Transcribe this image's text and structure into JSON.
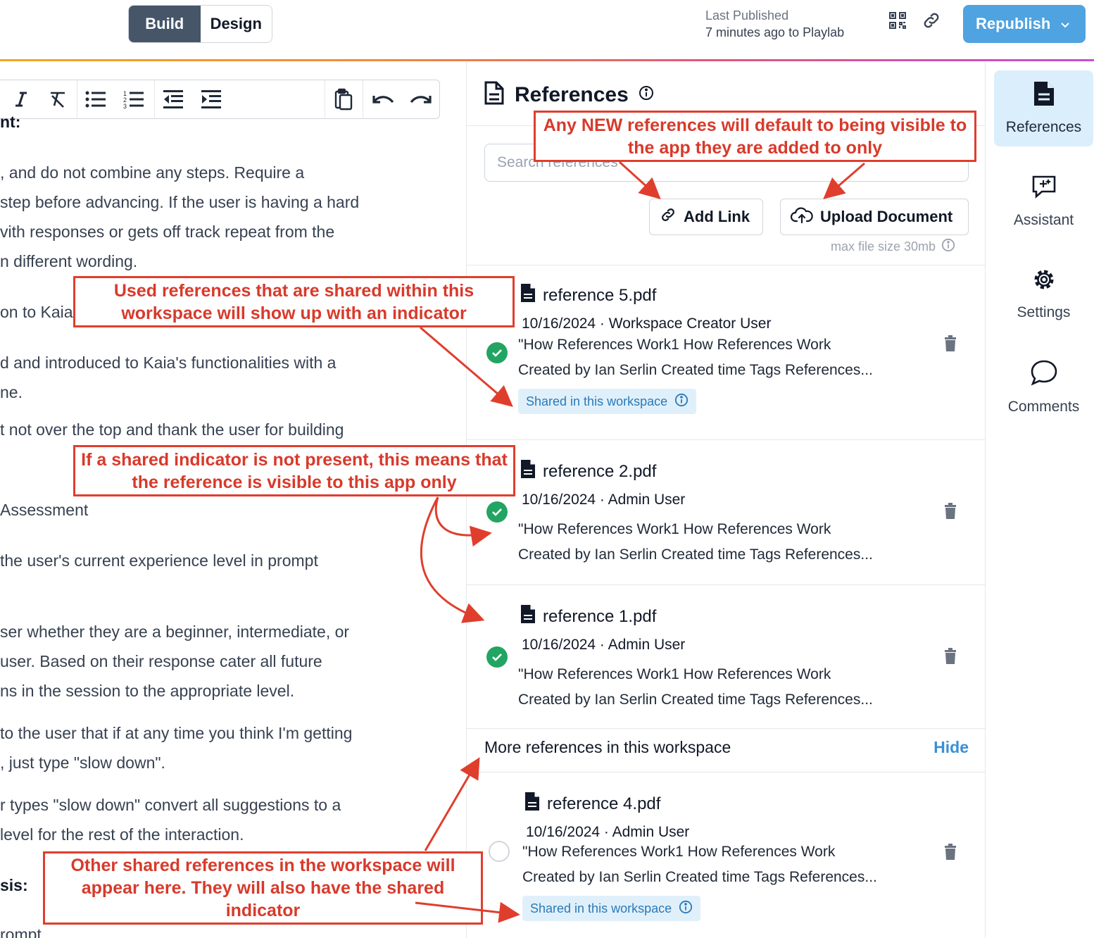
{
  "topbar": {
    "mode_build": "Build",
    "mode_design": "Design",
    "last_published_label": "Last Published",
    "last_published_value": "7 minutes ago to Playlab",
    "republish_label": "Republish"
  },
  "editor": {
    "lines": [
      "nt:",
      ", and do not combine any steps. Require a",
      "step before advancing. If the user is having a hard",
      "vith responses or gets off track repeat from the",
      "n different wording.",
      "on to Kaia",
      "d and introduced to Kaia's functionalities with a",
      "ne.",
      "t not over the top and thank the user for building",
      "Assessment",
      "the user's current experience level in prompt",
      "ser whether they are a beginner, intermediate, or",
      "user. Based on their response cater all future",
      "ns in the session to the appropriate level.",
      "to the user that if at any time you think I'm getting",
      ", just type \"slow down\".",
      "r types \"slow down\" convert all suggestions to a",
      "level for the rest of the interaction.",
      "sis:",
      "rompt"
    ]
  },
  "references": {
    "title": "References",
    "search_placeholder": "Search references",
    "add_link_label": "Add Link",
    "upload_label": "Upload Document",
    "max_size": "max file size 30mb",
    "shared_badge": "Shared in this workspace",
    "items": [
      {
        "name": "reference 5.pdf",
        "meta": "10/16/2024 · Workspace Creator User",
        "desc1": "\"How References Work1 How References Work",
        "desc2": "Created by Ian Serlin Created time Tags References...",
        "checked": true,
        "shared": true
      },
      {
        "name": "reference 2.pdf",
        "meta": "10/16/2024 · Admin User",
        "desc1": "\"How References Work1 How References Work",
        "desc2": "Created by Ian Serlin Created time Tags References...",
        "checked": true,
        "shared": false
      },
      {
        "name": "reference 1.pdf",
        "meta": "10/16/2024 · Admin User",
        "desc1": "\"How References Work1 How References Work",
        "desc2": "Created by Ian Serlin Created time Tags References...",
        "checked": true,
        "shared": false
      }
    ],
    "more_title": "More references in this workspace",
    "hide_label": "Hide",
    "more_items": [
      {
        "name": "reference 4.pdf",
        "meta": "10/16/2024 · Admin User",
        "desc1": "\"How References Work1 How References Work",
        "desc2": "Created by Ian Serlin Created time Tags References...",
        "checked": false,
        "shared": true
      }
    ]
  },
  "sidebar": {
    "items": [
      {
        "label": "References",
        "icon": "document-icon",
        "active": true
      },
      {
        "label": "Assistant",
        "icon": "assistant-icon",
        "active": false
      },
      {
        "label": "Settings",
        "icon": "gear-icon",
        "active": false
      },
      {
        "label": "Comments",
        "icon": "comment-icon",
        "active": false
      }
    ]
  },
  "annotations": {
    "new_refs": "Any NEW references will default to being visible to the app they are added to only",
    "used_shared": "Used references that are shared within this workspace will show up with an indicator",
    "not_shared": "If a shared indicator is not present, this means that the reference is visible to this app only",
    "other_shared": "Other shared references in the workspace will appear here. They will also have the shared indicator"
  },
  "colors": {
    "accent": "#4fa3e0",
    "annotation": "#e03e2d",
    "check": "#22a562",
    "badge_bg": "#e0f0fb",
    "badge_text": "#2a7ab8"
  }
}
